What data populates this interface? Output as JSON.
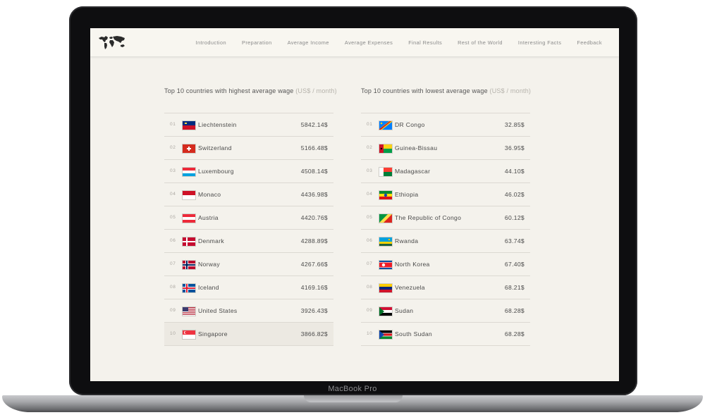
{
  "laptop_label": "MacBook Pro",
  "logo_icon": "world-map-icon",
  "nav": [
    {
      "label": "Introduction"
    },
    {
      "label": "Preparation"
    },
    {
      "label": "Average Income"
    },
    {
      "label": "Average Expenses"
    },
    {
      "label": "Final Results"
    },
    {
      "label": "Rest of the World"
    },
    {
      "label": "Interesting Facts"
    },
    {
      "label": "Feedback"
    }
  ],
  "highest": {
    "title": "Top 10 countries with highest average wage",
    "unit": "(US$ / month)",
    "rows": [
      {
        "rank": "01",
        "country": "Liechtenstein",
        "value": "5842.14$",
        "flag": "liechtenstein-flag-icon"
      },
      {
        "rank": "02",
        "country": "Switzerland",
        "value": "5166.48$",
        "flag": "switzerland-flag-icon"
      },
      {
        "rank": "03",
        "country": "Luxembourg",
        "value": "4508.14$",
        "flag": "luxembourg-flag-icon"
      },
      {
        "rank": "04",
        "country": "Monaco",
        "value": "4436.98$",
        "flag": "monaco-flag-icon"
      },
      {
        "rank": "05",
        "country": "Austria",
        "value": "4420.76$",
        "flag": "austria-flag-icon"
      },
      {
        "rank": "06",
        "country": "Denmark",
        "value": "4288.89$",
        "flag": "denmark-flag-icon"
      },
      {
        "rank": "07",
        "country": "Norway",
        "value": "4267.66$",
        "flag": "norway-flag-icon"
      },
      {
        "rank": "08",
        "country": "Iceland",
        "value": "4169.16$",
        "flag": "iceland-flag-icon"
      },
      {
        "rank": "09",
        "country": "United States",
        "value": "3926.43$",
        "flag": "united-states-flag-icon"
      },
      {
        "rank": "10",
        "country": "Singapore",
        "value": "3866.82$",
        "flag": "singapore-flag-icon"
      }
    ]
  },
  "lowest": {
    "title": "Top 10 countries with lowest average wage",
    "unit": "(US$ / month)",
    "rows": [
      {
        "rank": "01",
        "country": "DR Congo",
        "value": "32.85$",
        "flag": "dr-congo-flag-icon"
      },
      {
        "rank": "02",
        "country": "Guinea-Bissau",
        "value": "36.95$",
        "flag": "guinea-bissau-flag-icon"
      },
      {
        "rank": "03",
        "country": "Madagascar",
        "value": "44.10$",
        "flag": "madagascar-flag-icon"
      },
      {
        "rank": "04",
        "country": "Ethiopia",
        "value": "46.02$",
        "flag": "ethiopia-flag-icon"
      },
      {
        "rank": "05",
        "country": "The Republic of Congo",
        "value": "60.12$",
        "flag": "republic-of-congo-flag-icon"
      },
      {
        "rank": "06",
        "country": "Rwanda",
        "value": "63.74$",
        "flag": "rwanda-flag-icon"
      },
      {
        "rank": "07",
        "country": "North Korea",
        "value": "67.40$",
        "flag": "north-korea-flag-icon"
      },
      {
        "rank": "08",
        "country": "Venezuela",
        "value": "68.21$",
        "flag": "venezuela-flag-icon"
      },
      {
        "rank": "09",
        "country": "Sudan",
        "value": "68.28$",
        "flag": "sudan-flag-icon"
      },
      {
        "rank": "10",
        "country": "South Sudan",
        "value": "68.28$",
        "flag": "south-sudan-flag-icon"
      }
    ]
  },
  "colors": {
    "screen_bg": "#f4f2ec",
    "nav_bg": "#f8f6f0",
    "text": "#4a4a4a",
    "muted": "#aaa6a0",
    "divider": "#dcd9d2",
    "highlight_row": "#ece9e2"
  }
}
